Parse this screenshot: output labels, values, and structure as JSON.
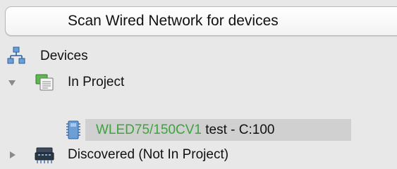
{
  "scan_button": {
    "label": "Scan Wired Network for devices"
  },
  "tree": {
    "root": {
      "label": "Devices",
      "icon": "network-tree-icon"
    },
    "groups": [
      {
        "label": "In Project",
        "icon": "project-folder-icon",
        "expanded": true,
        "items": [
          {
            "device_name": "WLED75/150CV1",
            "details": " test - C:100",
            "icon": "device-module-icon",
            "name_color": "#3ea33e",
            "selected": true
          }
        ]
      },
      {
        "label": "Discovered (Not In Project)",
        "icon": "network-switch-icon",
        "expanded": false,
        "items": []
      }
    ]
  }
}
